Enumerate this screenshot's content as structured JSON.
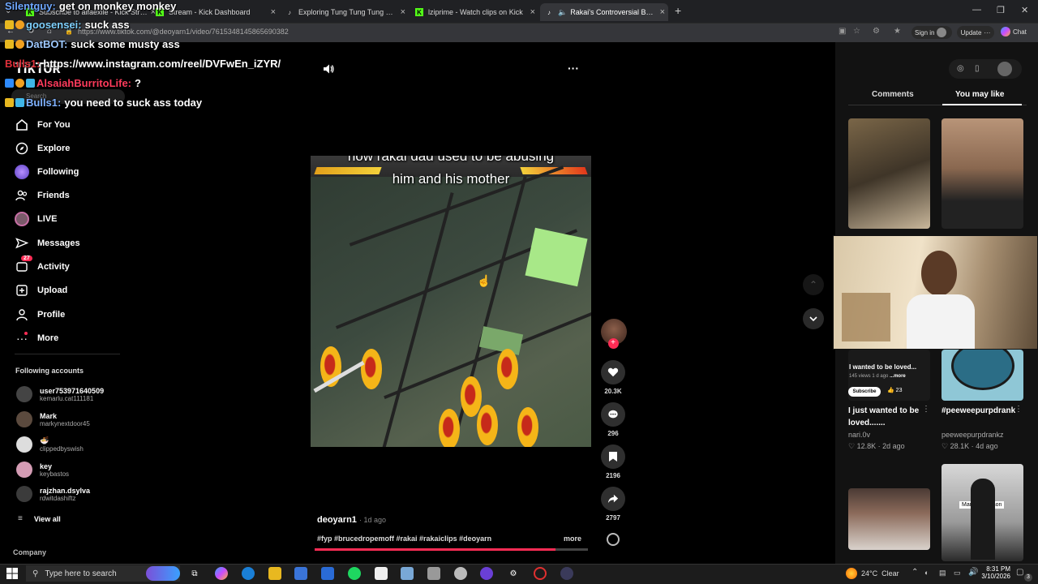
{
  "browser": {
    "tabs": [
      {
        "label": "Subscribe to alfaexile - Kick Stream",
        "close": "×",
        "favicon": "kick"
      },
      {
        "label": "Stream - Kick Dashboard",
        "close": "×",
        "favicon": "kick"
      },
      {
        "label": "Exploring Tung Tung Tung Sahur",
        "close": "×",
        "favicon": "tiktok"
      },
      {
        "label": "lziprime - Watch clips on Kick",
        "close": "×",
        "favicon": "kick"
      },
      {
        "label": "Rakai's Controversial Behavio",
        "close": "×",
        "favicon": "tiktok"
      }
    ],
    "new_tab": "+",
    "url": "https://www.tiktok.com/@deoyarn1/video/7615348145865690382",
    "sign_in": "Sign in",
    "update": "Update",
    "chat": "Chat",
    "window_controls": {
      "minimize": "—",
      "restore": "❐",
      "close": "✕"
    }
  },
  "tiktok": {
    "logo": "TikTok",
    "search_placeholder": "Search",
    "nav": [
      {
        "label": "For You",
        "icon": "home-icon"
      },
      {
        "label": "Explore",
        "icon": "compass-icon"
      },
      {
        "label": "Following",
        "icon": "following-avatar-icon"
      },
      {
        "label": "Friends",
        "icon": "friends-icon"
      },
      {
        "label": "LIVE",
        "icon": "live-icon"
      },
      {
        "label": "Messages",
        "icon": "messages-icon"
      },
      {
        "label": "Activity",
        "icon": "activity-icon",
        "badge": "27"
      },
      {
        "label": "Upload",
        "icon": "upload-icon"
      },
      {
        "label": "Profile",
        "icon": "profile-icon"
      },
      {
        "label": "More",
        "icon": "more-icon"
      }
    ],
    "following_header": "Following accounts",
    "following_accounts": [
      {
        "name": "user753971640509",
        "handle": "kemarlu.cat111181"
      },
      {
        "name": "Mark",
        "handle": "markynextdoor45"
      },
      {
        "name": "🍜",
        "handle": "clippedbyswish"
      },
      {
        "name": "key",
        "handle": "keybastos"
      },
      {
        "name": "rajzhan.dsylva",
        "handle": "rdwitdashiftz"
      }
    ],
    "view_all": "View all",
    "company": "Company",
    "video": {
      "caption_line1": "how rakai dad used to be abusing",
      "caption_line2": "him and his mother",
      "author": "deoyarn1",
      "posted": "1d ago",
      "hashtags": "#fyp #brucedropemoff #rakai #rakaiclips #deoyarn",
      "more": "more",
      "likes": "20.3K",
      "comments": "296",
      "saves": "2196",
      "shares": "2797",
      "progress": 0.88
    },
    "right_panel": {
      "tabs": [
        "Comments",
        "You may like"
      ],
      "active_tab": "You may like",
      "cards": [
        {
          "title": "I just wanted to be loved.......",
          "user": "nari.0v",
          "views": "12.8K",
          "age": "2d ago"
        },
        {
          "title": "#peeweepurpdrank",
          "user": "peeweepurpdrankz",
          "views": "28.1K",
          "age": "4d ago"
        }
      ],
      "partial_card": {
        "title": "I wanted to be loved...",
        "views": "145 views",
        "age": "1 d ago",
        "more": "...more",
        "subscribe": "Subscribe",
        "likes": "23"
      },
      "thumb_label": "Marilyn Manson"
    }
  },
  "chat_overlay": [
    {
      "user": "Silentguy:",
      "message": "get on monkey monkey",
      "color": "#6fa8ff"
    },
    {
      "user": "goosensei:",
      "message": "suck ass",
      "color": "#7fd1ff"
    },
    {
      "user": "DatBOT:",
      "message": "suck some musty ass",
      "color": "#9ec9ff"
    },
    {
      "user": "Bulls1:",
      "message": "https://www.instagram.com/reel/DVFwEn_iZYR/",
      "color": "#e0303a"
    },
    {
      "user": "AlsaiahBurritoLife:",
      "message": "?",
      "color": "#ff3b5c"
    },
    {
      "user": "Bulls1:",
      "message": "you need to suck ass today",
      "color": "#7fb2ff"
    }
  ],
  "taskbar": {
    "search_placeholder": "Type here to search",
    "weather": "24°C  Clear",
    "time": "8:31 PM",
    "date": "3/10/2026",
    "notification_count": "3"
  },
  "colors": {
    "tiktok_red": "#fe2c55",
    "kick_green": "#53fc18",
    "panel_bg": "#121212"
  }
}
